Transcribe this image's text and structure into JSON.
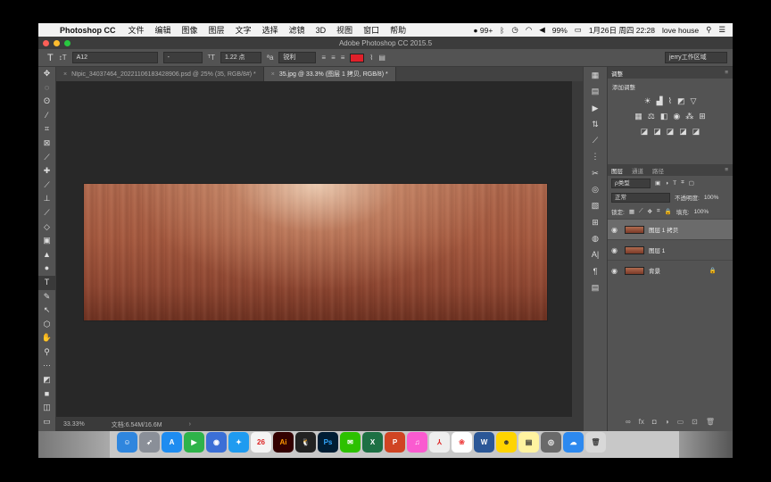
{
  "menubar": {
    "apple": "",
    "app_name": "Photoshop CC",
    "items": [
      "文件",
      "编辑",
      "图像",
      "图层",
      "文字",
      "选择",
      "滤镜",
      "3D",
      "视图",
      "窗口",
      "帮助"
    ],
    "status_badge": "99+",
    "battery": "99%",
    "datetime": "1月26日 周四 22:28",
    "user": "love house"
  },
  "window": {
    "title": "Adobe Photoshop CC 2015.5"
  },
  "options_bar": {
    "tool_glyph": "T",
    "font_name": "A12",
    "font_size": "1.22 点",
    "anti_alias": "锐利",
    "text_color": "#e0202a",
    "workspace": "jerry工作区域"
  },
  "tabs": [
    {
      "label": "NIpic_34037464_20221106183428906.psd @ 25% (35, RGB/8#) *"
    },
    {
      "label": "35.jpg @ 33.3% (图层 1 拷贝, RGB/8) *"
    }
  ],
  "status_bar": {
    "zoom": "33.33%",
    "doc_info": "文档:6.54M/16.6M"
  },
  "adjustments": {
    "tabs": [
      "调整"
    ],
    "add_label": "添加调整"
  },
  "layers_panel": {
    "tabs": [
      "图层",
      "通道",
      "路径"
    ],
    "filter_label": "ρ类型",
    "blend_mode": "正常",
    "opacity_label": "不透明度:",
    "opacity_value": "100%",
    "lock_label": "锁定:",
    "fill_label": "填充:",
    "fill_value": "100%",
    "layers": [
      {
        "name": "图层 1 拷贝",
        "selected": true
      },
      {
        "name": "图层 1",
        "selected": false
      },
      {
        "name": "背景",
        "selected": false
      }
    ]
  },
  "dock": {
    "calendar_day": "26"
  }
}
